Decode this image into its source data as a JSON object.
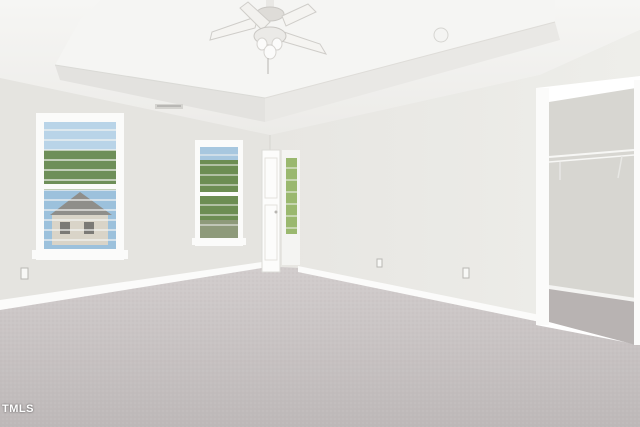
{
  "scene": {
    "description_label": "",
    "room": {
      "windows": 3,
      "ceiling_fan": true,
      "closet": "walk-in",
      "floor": "carpet"
    }
  },
  "watermark": {
    "text": "TMLS"
  },
  "colors": {
    "wall": "#e6e5e1",
    "ceiling": "#f3f3f1",
    "carpet": "#c9c4c4",
    "trim": "#ffffff",
    "closet_wall": "#d9d8d3"
  },
  "icons": [
    "ceiling-fan-icon"
  ]
}
